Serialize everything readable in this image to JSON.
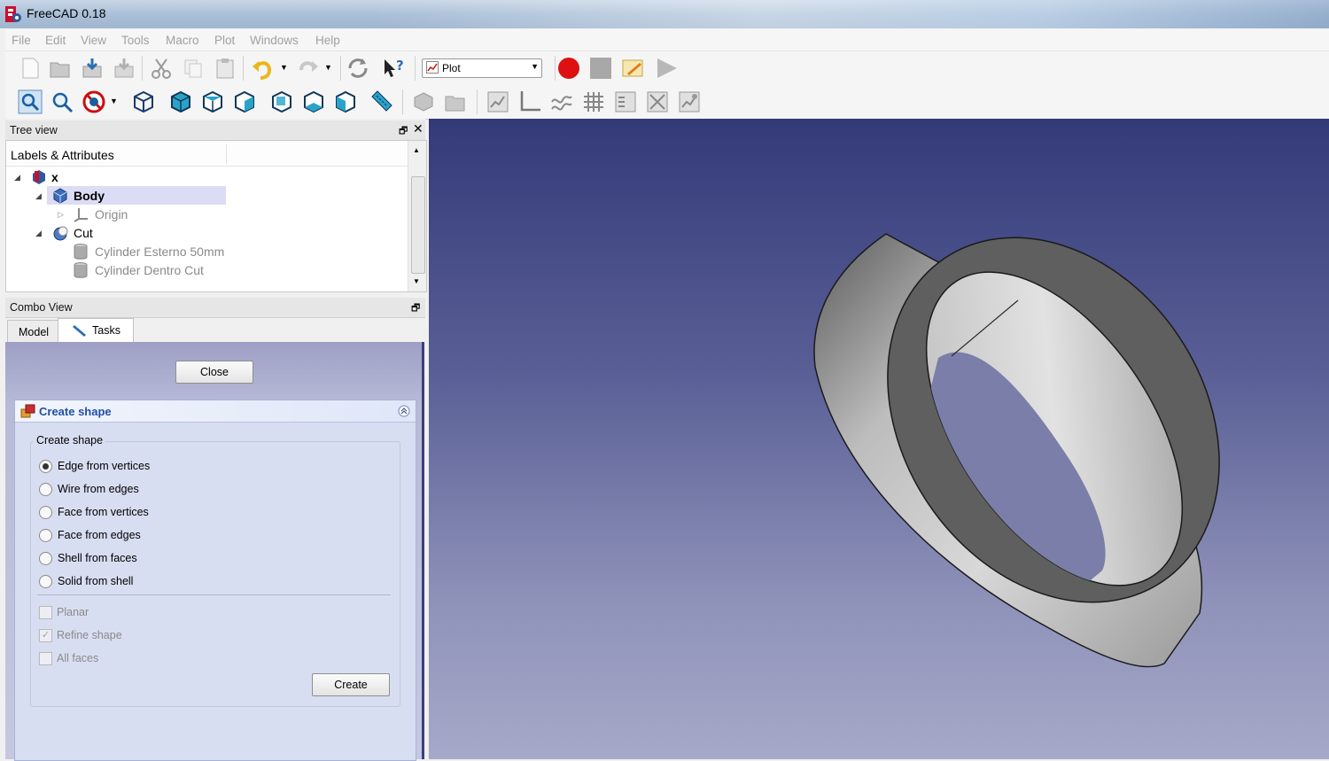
{
  "window": {
    "title": "FreeCAD 0.18"
  },
  "menu": [
    "File",
    "Edit",
    "View",
    "Tools",
    "Macro",
    "Plot",
    "Windows",
    "Help"
  ],
  "toolbar": {
    "workbench": "Plot"
  },
  "tree": {
    "title": "Tree view",
    "column": "Labels & Attributes",
    "nodes": {
      "doc": "x",
      "body": "Body",
      "origin": "Origin",
      "cut": "Cut",
      "cyl1": "Cylinder Esterno 50mm",
      "cyl2": "Cylinder Dentro Cut"
    }
  },
  "combo": {
    "title": "Combo View",
    "tabs": [
      "Model",
      "Tasks"
    ],
    "close": "Close"
  },
  "create_shape": {
    "panel_title": "Create shape",
    "group_title": "Create shape",
    "options": [
      "Edge from vertices",
      "Wire from edges",
      "Face from vertices",
      "Face from edges",
      "Shell from faces",
      "Solid from shell"
    ],
    "selected": 0,
    "checks": [
      "Planar",
      "Refine shape",
      "All faces"
    ],
    "create": "Create"
  },
  "colors": {
    "viewport_top": "#333a78",
    "viewport_bottom": "#a6a9c8",
    "record": "#dd1111",
    "panel_header_text": "#1f4fa8"
  }
}
